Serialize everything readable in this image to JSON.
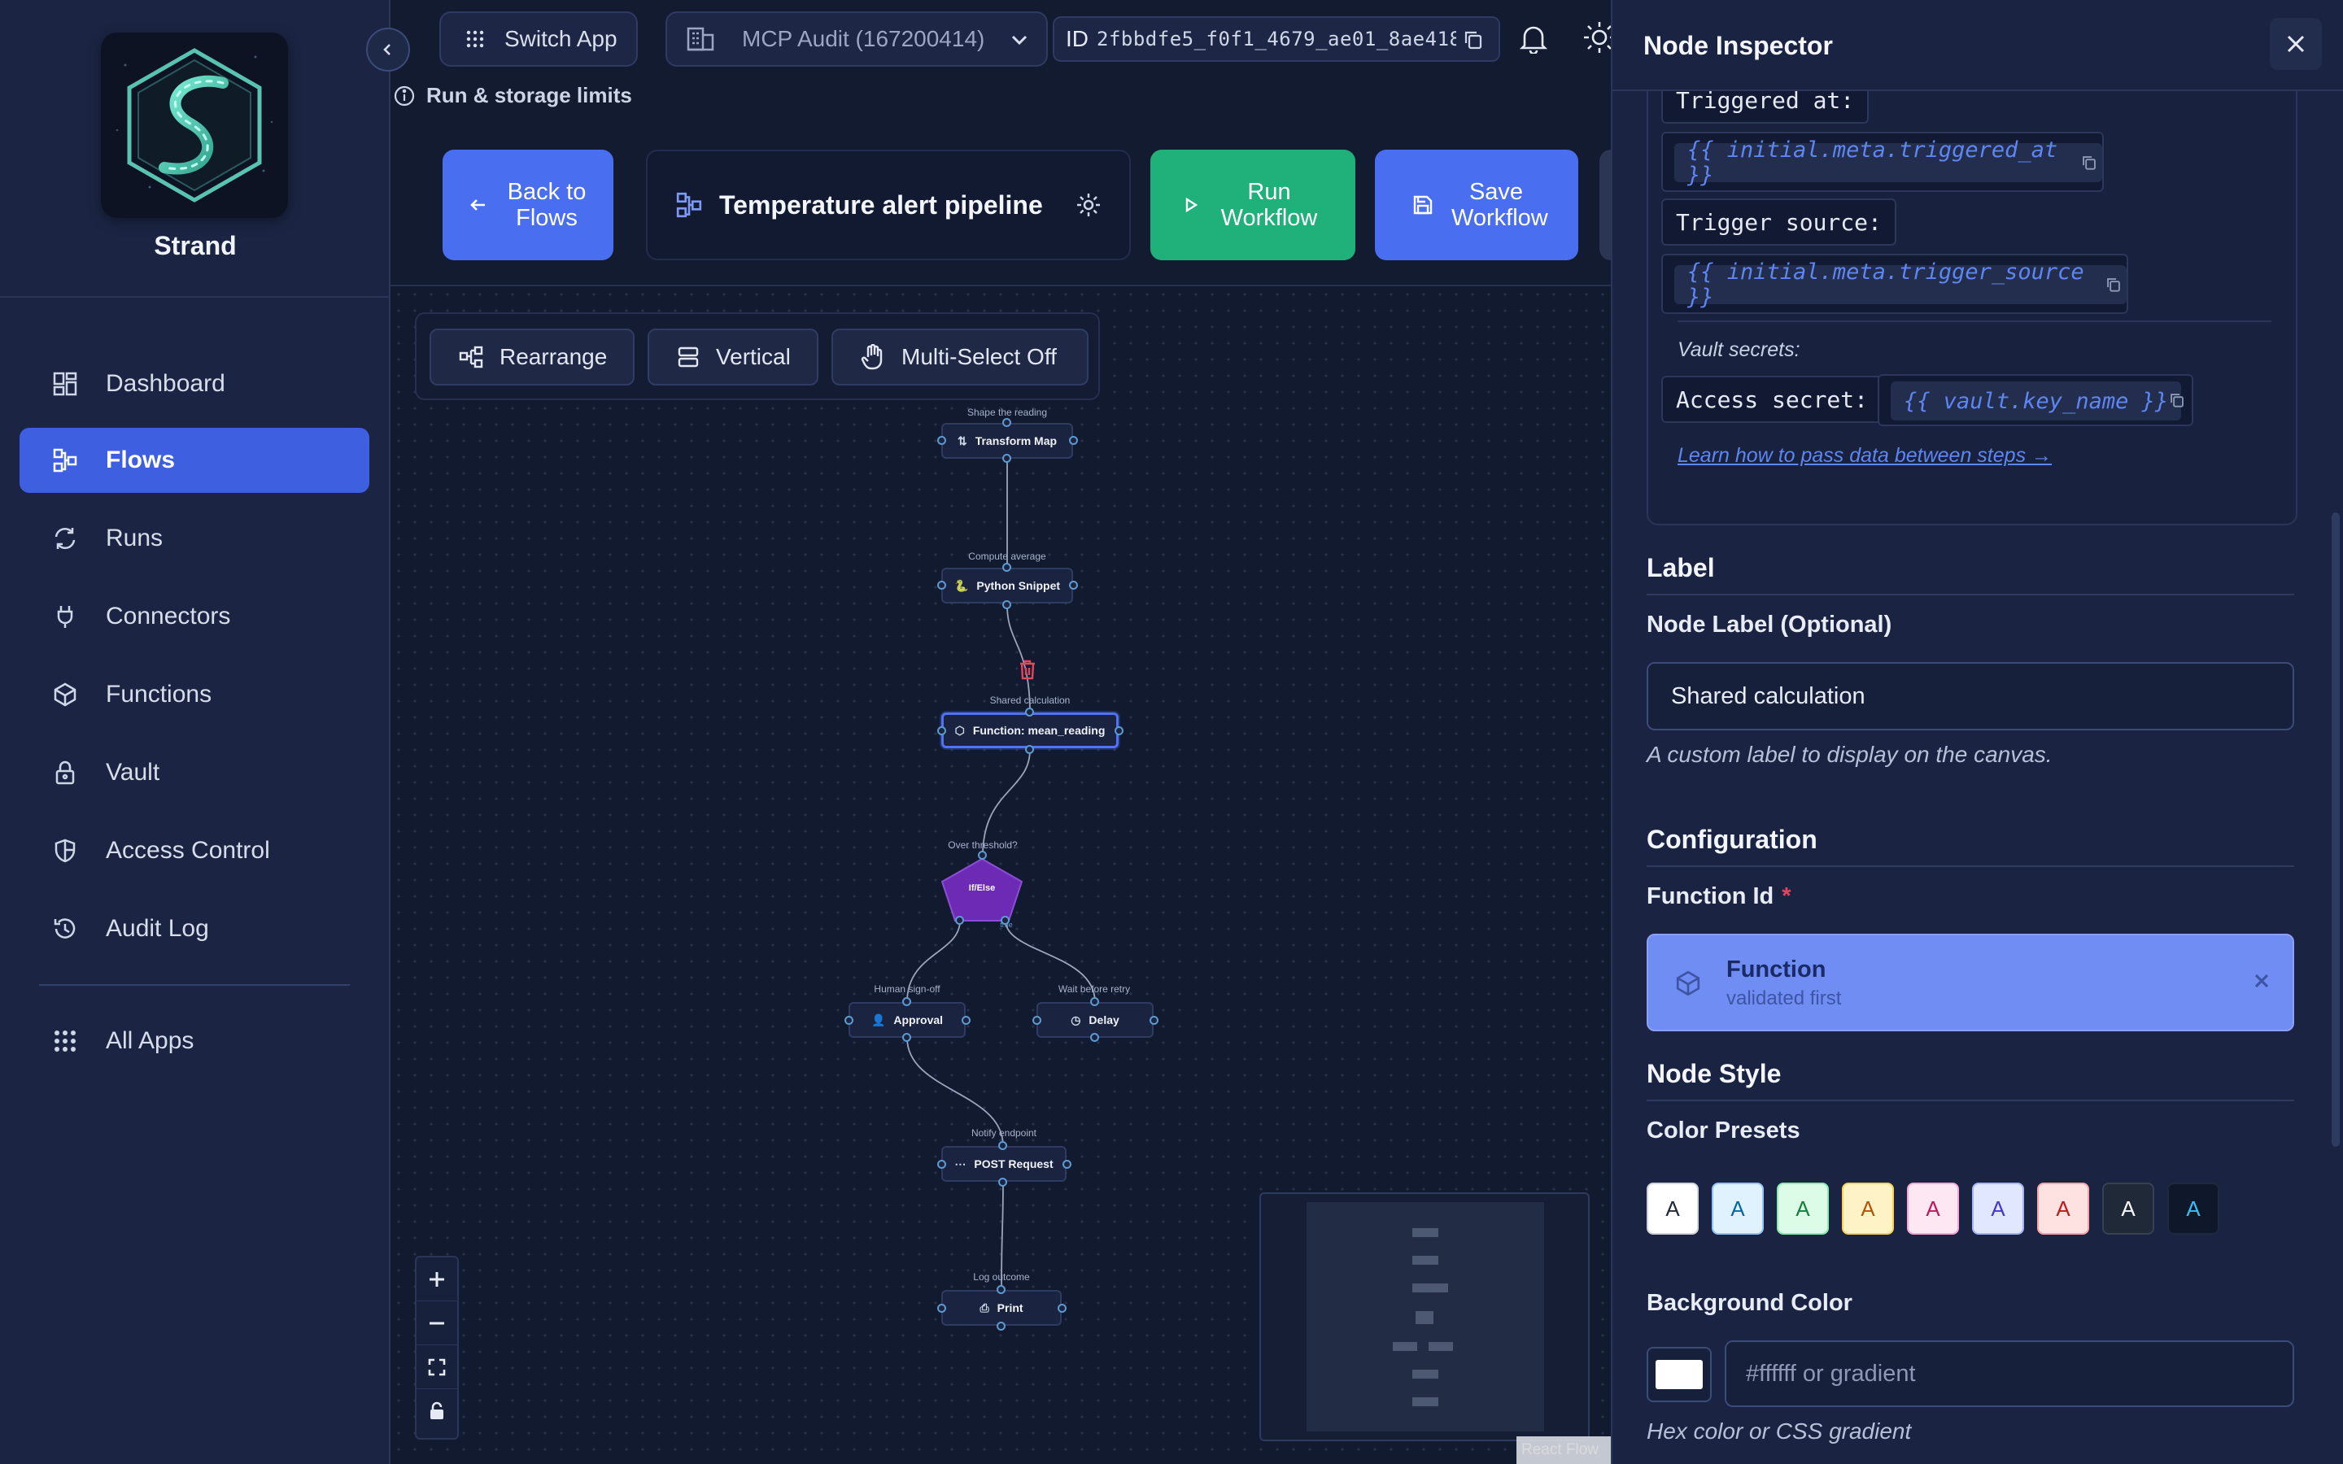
{
  "app": {
    "name": "Strand"
  },
  "sidebar": {
    "items": [
      {
        "label": "Dashboard",
        "icon": "dashboard-icon",
        "active": false
      },
      {
        "label": "Flows",
        "icon": "flows-icon",
        "active": true
      },
      {
        "label": "Runs",
        "icon": "runs-icon",
        "active": false
      },
      {
        "label": "Connectors",
        "icon": "plug-icon",
        "active": false
      },
      {
        "label": "Functions",
        "icon": "cube-icon",
        "active": false
      },
      {
        "label": "Vault",
        "icon": "lock-icon",
        "active": false
      },
      {
        "label": "Access Control",
        "icon": "shield-icon",
        "active": false
      },
      {
        "label": "Audit Log",
        "icon": "history-icon",
        "active": false
      }
    ],
    "all_apps": "All Apps"
  },
  "topbar": {
    "switch_app": "Switch App",
    "org": "MCP Audit (167200414)",
    "id_label": "ID",
    "id_value": "2fbbdfe5_f0f1_4679_ae01_8ae418a…",
    "limits": "Run & storage limits"
  },
  "header": {
    "back_label": "Back to Flows",
    "flow_title": "Temperature alert pipeline",
    "run_label": "Run Workflow",
    "save_label": "Save Workflow"
  },
  "toolbar": {
    "rearrange": "Rearrange",
    "vertical": "Vertical",
    "multiselect": "Multi-Select Off"
  },
  "nodes": {
    "transform": {
      "caption": "Shape the reading",
      "label": "Transform Map"
    },
    "python": {
      "caption": "Compute average",
      "label": "Python Snippet"
    },
    "function": {
      "caption": "Shared calculation",
      "label": "Function: mean_reading"
    },
    "ifelse": {
      "caption": "Over threshold?",
      "label": "If/Else",
      "true_tag": "true"
    },
    "approval": {
      "caption": "Human sign-off",
      "label": "Approval"
    },
    "delay": {
      "caption": "Wait before retry",
      "label": "Delay"
    },
    "post": {
      "caption": "Notify endpoint",
      "label": "POST Request"
    },
    "print": {
      "caption": "Log outcome",
      "label": "Print"
    }
  },
  "canvas": {
    "attribution": "React Flow"
  },
  "inspector": {
    "title": "Node Inspector",
    "vars": {
      "triggered_at_key": "Triggered at:",
      "triggered_at_tmpl": "{{ initial.meta.triggered_at }}",
      "trigger_source_key": "Trigger source:",
      "trigger_source_tmpl": "{{ initial.meta.trigger_source }}",
      "vault_label": "Vault secrets:",
      "access_secret_key": "Access secret:",
      "access_secret_tmpl": "{{ vault.key_name }}",
      "learn_link": "Learn how to pass data between steps →"
    },
    "label_section": "Label",
    "node_label_field": "Node Label (Optional)",
    "node_label_value": "Shared calculation",
    "node_label_help": "A custom label to display on the canvas.",
    "config_section": "Configuration",
    "function_id_field": "Function Id",
    "function_id_required": "*",
    "function_card_name": "Function",
    "function_card_sub": "validated first",
    "style_section": "Node Style",
    "color_presets_label": "Color Presets",
    "presets": [
      {
        "bg": "#ffffff",
        "fg": "#1f2937",
        "border": "#d1d5db",
        "letter": "A"
      },
      {
        "bg": "#e0f2fe",
        "fg": "#0369a1",
        "border": "#93c5fd",
        "letter": "A"
      },
      {
        "bg": "#dcfce7",
        "fg": "#15803d",
        "border": "#86efac",
        "letter": "A"
      },
      {
        "bg": "#fef3c7",
        "fg": "#b45309",
        "border": "#fcd34d",
        "letter": "A"
      },
      {
        "bg": "#fce7f3",
        "fg": "#be185d",
        "border": "#f9a8d4",
        "letter": "A"
      },
      {
        "bg": "#e0e7ff",
        "fg": "#4338ca",
        "border": "#a5b4fc",
        "letter": "A"
      },
      {
        "bg": "#fee2e2",
        "fg": "#b91c1c",
        "border": "#fca5a5",
        "letter": "A"
      },
      {
        "bg": "#1f2937",
        "fg": "#f9fafb",
        "border": "#374151",
        "letter": "A"
      },
      {
        "bg": "#0f172a",
        "fg": "#38bdf8",
        "border": "#1e293b",
        "letter": "A"
      }
    ],
    "bg_color_label": "Background Color",
    "bg_color_placeholder": "#ffffff or gradient",
    "bg_color_help": "Hex color or CSS gradient"
  },
  "colors": {
    "accent": "#4a6ef0",
    "run": "#20b07a",
    "ifelse": "#6d2bb5",
    "danger": "#e0465e"
  }
}
